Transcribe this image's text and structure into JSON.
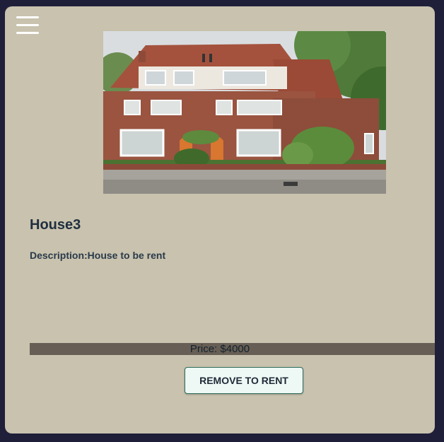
{
  "menu": {
    "icon": "hamburger-menu-icon"
  },
  "listing": {
    "image_alt": "House3 photo",
    "title": "House3",
    "description": "Description:House to be rent",
    "price": "Price: $4000",
    "action_label": "REMOVE TO RENT"
  },
  "colors": {
    "page_background": "#1f1f3a",
    "card_background": "#c8c2ae",
    "price_bar": "#675f55",
    "button_background": "#eef8f5",
    "button_border": "#2e6d5c"
  }
}
